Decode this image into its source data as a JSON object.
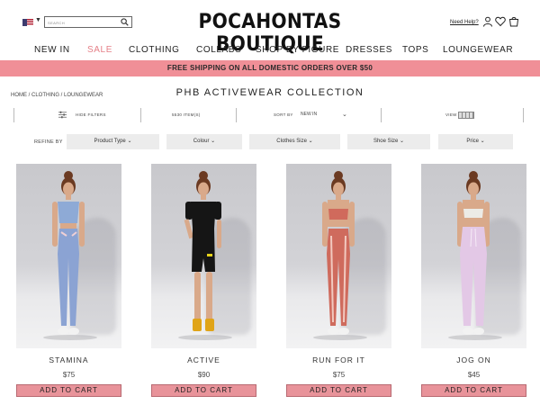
{
  "header": {
    "logo": "POCAHONTAS BOUTIQUE",
    "search_placeholder": "SEARCH",
    "help_link": "Need Help?",
    "icons": [
      "us-flag-icon",
      "search-icon",
      "user-icon",
      "heart-icon",
      "bag-icon"
    ]
  },
  "nav": {
    "items": [
      "NEW IN",
      "SALE",
      "CLOTHING",
      "COLLABS",
      "SHOP BY FIGURE",
      "DRESSES",
      "TOPS",
      "LOUNGEWEAR"
    ],
    "accent_item": "SALE",
    "accent_color": "#e57f87"
  },
  "banner": {
    "text": "FREE SHIPPING ON ALL DOMESTIC ORDERS OVER $50",
    "color": "#f08f97"
  },
  "breadcrumb": "HOME / CLOTHING / LOUNGEWEAR",
  "page_title": "PHB ACTIVEWEAR COLLECTION",
  "filter_bar": {
    "hide_filters": "HIDE FILTERS",
    "item_count": "5530 ITEM(S)",
    "sort_label": "SORT BY",
    "sort_value": "NEW IN",
    "view_label": "VIEW"
  },
  "refine": {
    "label": "REFINE BY",
    "filters": [
      "Product Type",
      "Colour",
      "Clothes Size",
      "Shoe Size",
      "Price"
    ]
  },
  "products": [
    {
      "name": "STAMINA",
      "price": "$75",
      "button": "ADD TO CART"
    },
    {
      "name": "ACTIVE",
      "price": "$90",
      "button": "ADD TO CART"
    },
    {
      "name": "RUN FOR IT",
      "price": "$75",
      "button": "ADD TO CART"
    },
    {
      "name": "JOG ON",
      "price": "$45",
      "button": "ADD TO CART"
    }
  ],
  "colors": {
    "add_to_cart": "#e8939a",
    "refine_bg": "#ececec"
  }
}
